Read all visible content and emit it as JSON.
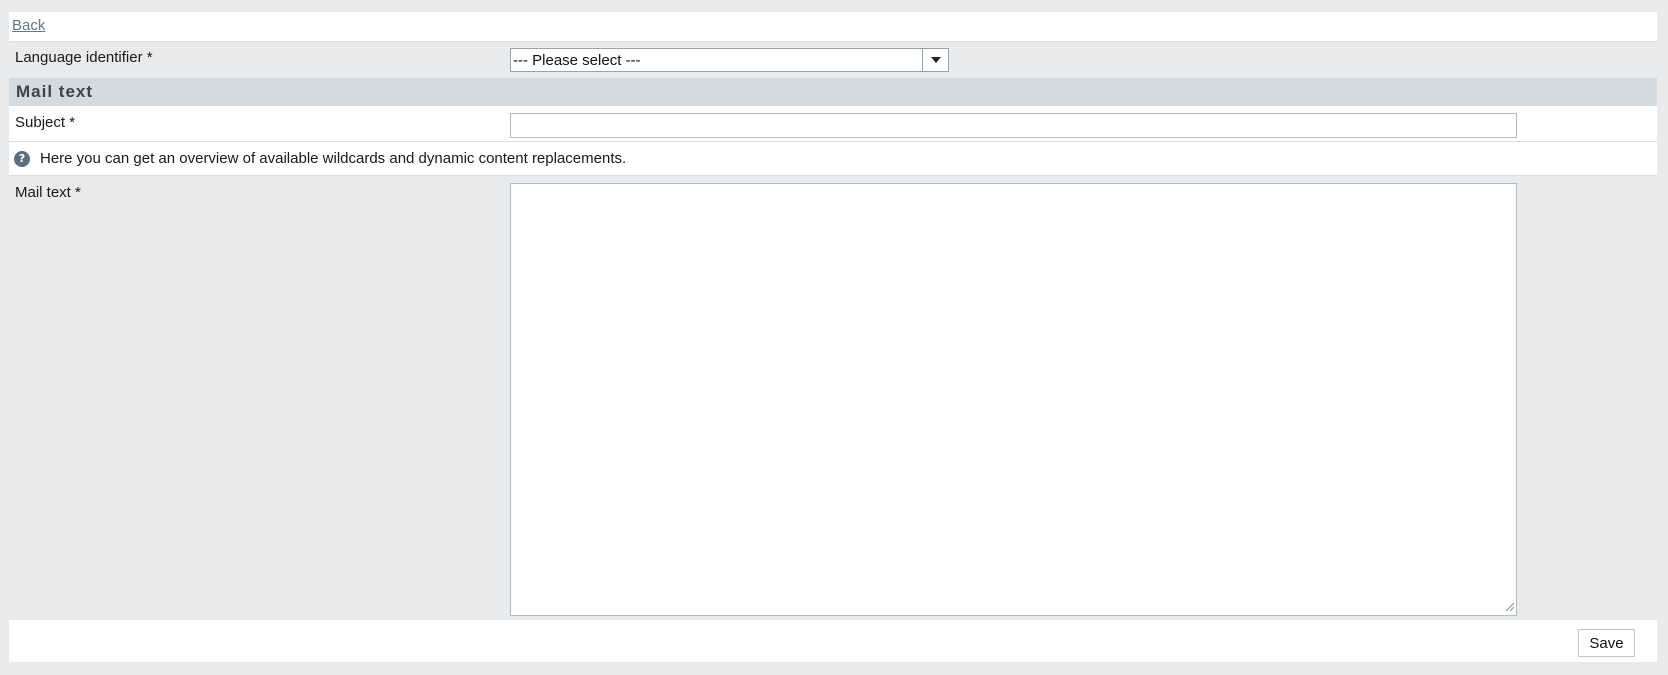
{
  "nav": {
    "back_label": "Back"
  },
  "form": {
    "language": {
      "label": "Language identifier *",
      "selected": "--- Please select ---"
    },
    "section_title": "Mail text",
    "subject": {
      "label": "Subject *",
      "value": ""
    },
    "help_text": "Here you can get an overview of available wildcards and dynamic content replacements.",
    "mail_text": {
      "label": "Mail text *",
      "value": ""
    }
  },
  "footer": {
    "save_label": "Save"
  },
  "icons": {
    "help": "help-circle-icon",
    "dropdown": "chevron-down-icon"
  },
  "colors": {
    "link": "#5f7a93",
    "section_header_bg": "#d3dbe1",
    "page_bg": "#e8eaec"
  }
}
